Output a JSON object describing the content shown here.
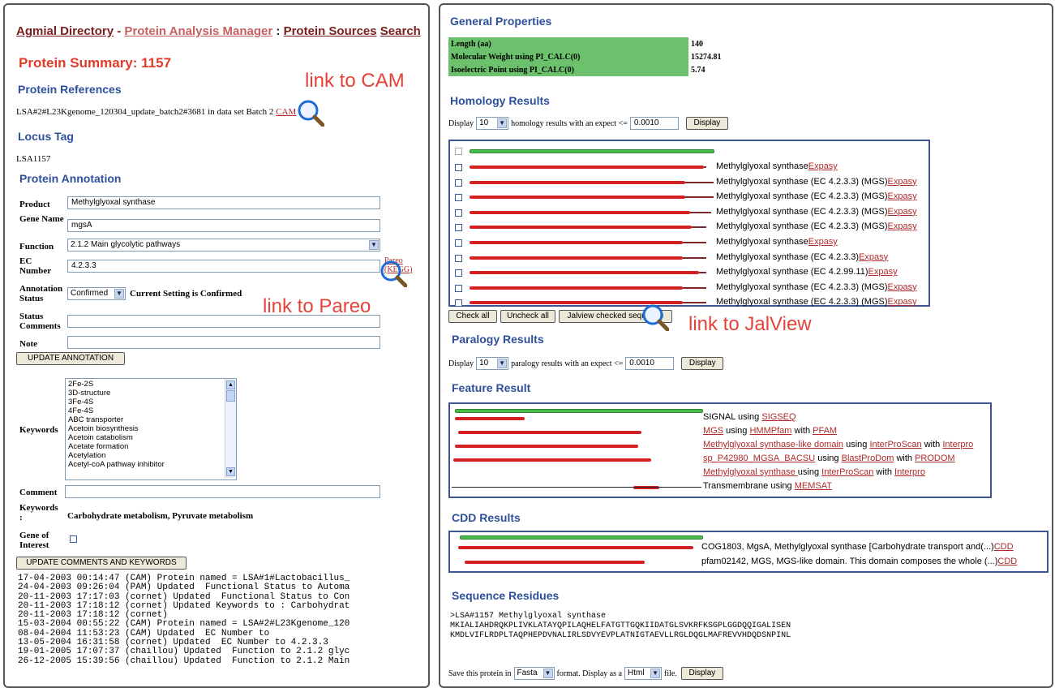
{
  "left_panel": {
    "nav": {
      "directory": "Agmial Directory",
      "sep1": " - ",
      "manager": "Protein Analysis Manager",
      "sep2": " : ",
      "sources": "Protein Sources",
      "search": "Search"
    },
    "summary_title": "Protein Summary: 1157",
    "references_heading": "Protein References",
    "reference_text": "LSA#2#L23Kgenome_120304_update_batch2#3681 in data set Batch 2",
    "cam_link": "CAM",
    "annotation_link_cam": "link to CAM",
    "locus_heading": "Locus Tag",
    "locus_value": "LSA1157",
    "annotation_heading": "Protein Annotation",
    "form": {
      "product_label": "Product",
      "product_value": "Methylglyoxal synthase",
      "gene_label": "Gene Name",
      "gene_value": "mgsA",
      "function_label": "Function",
      "function_value": "2.1.2 Main glycolytic pathways",
      "ec_label": "EC Number",
      "ec_value": "4.2.3.3",
      "pareo_link": "Pareo",
      "kegg_link": "(KEGG)",
      "status_label": "Annotation Status",
      "status_value": "Confirmed",
      "status_current": "Current Setting is Confirmed",
      "status_comments_label": "Status Comments",
      "note_label": "Note",
      "update_annotation_button": "UPDATE ANNOTATION",
      "keywords_label": "Keywords",
      "keyword_options": [
        "2Fe-2S",
        "3D-structure",
        "3Fe-4S",
        "4Fe-4S",
        "ABC transporter",
        "Acetoin biosynthesis",
        "Acetoin catabolism",
        "Acetate formation",
        "Acetylation",
        "Acetyl-coA pathway inhibitor"
      ],
      "comment_label": "Comment",
      "keywords2_label": "Keywords :",
      "keywords2_value": "Carbohydrate metabolism, Pyruvate metabolism",
      "gene_interest_label": "Gene of Interest",
      "update_comments_button": "UPDATE COMMENTS AND KEYWORDS"
    },
    "annotation_link_pareo": "link to Pareo",
    "history": [
      "17-04-2003 00:14:47 (CAM) Protein named = LSA#1#Lactobacillus_",
      "24-04-2003 09:26:04 (PAM) Updated  Functional Status to Automa",
      "20-11-2003 17:17:03 (cornet) Updated  Functional Status to Con",
      "20-11-2003 17:18:12 (cornet) Updated Keywords to : Carbohydrat",
      "20-11-2003 17:18:12 (cornet)",
      "15-03-2004 00:55:22 (CAM) Protein named = LSA#2#L23Kgenome_120",
      "08-04-2004 11:53:23 (CAM) Updated  EC Number to",
      "13-05-2004 16:31:58 (cornet) Updated  EC Number to 4.2.3.3",
      "19-01-2005 17:07:37 (chaillou) Updated  Function to 2.1.2 glyc",
      "26-12-2005 15:39:56 (chaillou) Updated  Function to 2.1.2 Main"
    ]
  },
  "right_panel": {
    "general_heading": "General Properties",
    "properties": [
      {
        "key": "Length (aa)",
        "value": "140"
      },
      {
        "key": "Molecular Weight using PI_CALC(0)",
        "value": "15274.81"
      },
      {
        "key": "Isoelectric Point using PI_CALC(0)",
        "value": "5.74"
      }
    ],
    "homology_heading": "Homology Results",
    "homology_display": {
      "prefix": "Display",
      "count": "10",
      "middle": "homology results with an expect <=",
      "expect": "0.0010",
      "button": "Display"
    },
    "homology_hits": [
      {
        "text": "Methylglyoxal synthase",
        "link": "Expasy",
        "length": 0.99,
        "tail": 0.0
      },
      {
        "text": "Methylglyoxal synthase (EC 4.2.3.3) (MGS)",
        "link": "Expasy",
        "length": 0.91,
        "tail": 0.03
      },
      {
        "text": "Methylglyoxal synthase (EC 4.2.3.3) (MGS)",
        "link": "Expasy",
        "length": 0.91,
        "tail": 0.03
      },
      {
        "text": "Methylglyoxal synthase (EC 4.2.3.3) (MGS)",
        "link": "Expasy",
        "length": 0.93,
        "tail": 0.02
      },
      {
        "text": "Methylglyoxal synthase (EC 4.2.3.3) (MGS)",
        "link": "Expasy",
        "length": 0.94,
        "tail": 0.0
      },
      {
        "text": "Methylglyoxal synthase",
        "link": "Expasy",
        "length": 0.9,
        "tail": 0.0
      },
      {
        "text": "Methylglyoxal synthase (EC 4.2.3.3)",
        "link": "Expasy",
        "length": 0.9,
        "tail": 0.0
      },
      {
        "text": "Methylglyoxal synthase (EC 4.2.99.11)",
        "link": "Expasy",
        "length": 0.97,
        "tail": 0.0
      },
      {
        "text": "Methylglyoxal synthase (EC 4.2.3.3) (MGS)",
        "link": "Expasy",
        "length": 0.9,
        "tail": 0.0
      },
      {
        "text": "Methylglyoxal synthase (EC 4.2.3.3) (MGS)",
        "link": "Expasy",
        "length": 0.9,
        "tail": 0.0
      }
    ],
    "homology_buttons": {
      "check_all": "Check all",
      "uncheck_all": "Uncheck all",
      "jalview": "Jalview checked sequence"
    },
    "annotation_link_jalview": "link to JalView",
    "paralogy_heading": "Paralogy Results",
    "paralogy_display": {
      "prefix": "Display",
      "count": "10",
      "middle": "paralogy results with an expect <=",
      "expect": "0.0010",
      "button": "Display"
    },
    "feature_heading": "Feature Result",
    "features": [
      {
        "parts": [
          {
            "t": "SIGNAL using "
          },
          {
            "l": "SIGSEQ"
          }
        ]
      },
      {
        "parts": [
          {
            "l": "MGS"
          },
          {
            "t": " using "
          },
          {
            "l": "HMMPfam"
          },
          {
            "t": " with "
          },
          {
            "l": "PFAM"
          }
        ]
      },
      {
        "parts": [
          {
            "l": "Methylglyoxal synthase-like domain"
          },
          {
            "t": " using "
          },
          {
            "l": "InterProScan"
          },
          {
            "t": " with "
          },
          {
            "l": "Interpro"
          }
        ]
      },
      {
        "parts": [
          {
            "l": "sp_P42980_MGSA_BACSU"
          },
          {
            "t": " using "
          },
          {
            "l": "BlastProDom"
          },
          {
            "t": " with "
          },
          {
            "l": "PRODOM"
          }
        ]
      },
      {
        "parts": [
          {
            "l": "Methylglyoxal synthase "
          },
          {
            "t": "using "
          },
          {
            "l": "InterProScan"
          },
          {
            "t": " with "
          },
          {
            "l": "Interpro"
          }
        ]
      },
      {
        "parts": [
          {
            "t": "Transmembrane using "
          },
          {
            "l": "MEMSAT"
          }
        ]
      }
    ],
    "cdd_heading": "CDD Results",
    "cdd_hits": [
      {
        "text": "COG1803, MgsA, Methylglyoxal synthase [Carbohydrate transport and(...)",
        "link": "CDD"
      },
      {
        "text": "pfam02142, MGS, MGS-like domain. This domain composes the whole (...)",
        "link": "CDD"
      }
    ],
    "sequence_heading": "Sequence Residues",
    "sequence_lines": [
      ">LSA#1157 Methylglyoxal synthase",
      "MKIALIAHDRQKPLIVKLATAYQPILAQHELFATGTTGQKIIDATGLSVKRFKSGPLGGDQQIGALISEN",
      "KMDLVIFLRDPLTAQPHEPDVNALIRLSDVYEVPLATNIGTAEVLLRGLDQGLMAFREVVHDQDSNPINL"
    ],
    "save": {
      "prefix": "Save this protein in",
      "format": "Fasta",
      "middle": "format. Display as a",
      "type": "Html",
      "suffix": "file.",
      "button": "Display"
    }
  }
}
